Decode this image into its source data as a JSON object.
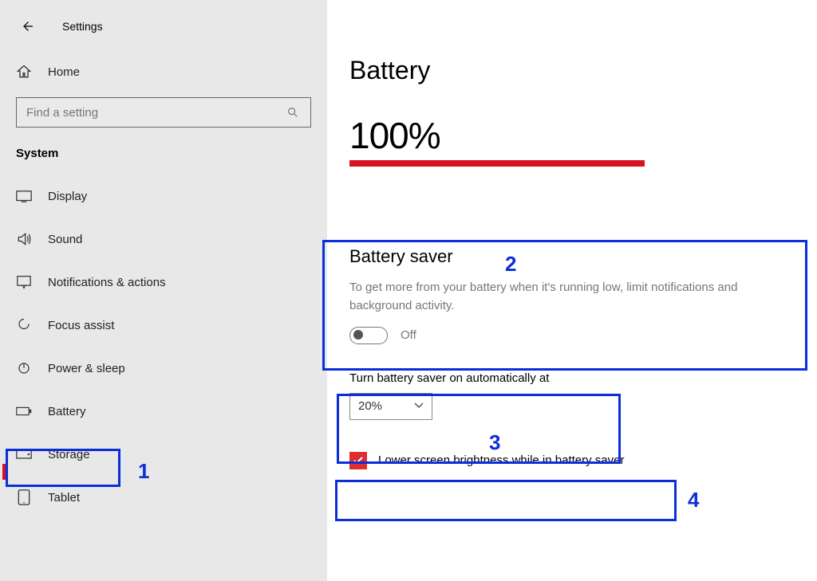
{
  "header": {
    "title": "Settings"
  },
  "sidebar": {
    "home_label": "Home",
    "search_placeholder": "Find a setting",
    "category_heading": "System",
    "items": [
      {
        "label": "Display"
      },
      {
        "label": "Sound"
      },
      {
        "label": "Notifications & actions"
      },
      {
        "label": "Focus assist"
      },
      {
        "label": "Power & sleep"
      },
      {
        "label": "Battery"
      },
      {
        "label": "Storage"
      },
      {
        "label": "Tablet"
      }
    ]
  },
  "main": {
    "page_title": "Battery",
    "battery_percent": "100%",
    "saver": {
      "heading": "Battery saver",
      "description": "To get more from your battery when it's running low, limit notifications and background activity.",
      "toggle_state_label": "Off"
    },
    "auto_on": {
      "label": "Turn battery saver on automatically at",
      "value": "20%"
    },
    "brightness_checkbox_label": "Lower screen brightness while in battery saver"
  },
  "annotations": {
    "n1": "1",
    "n2": "2",
    "n3": "3",
    "n4": "4"
  }
}
